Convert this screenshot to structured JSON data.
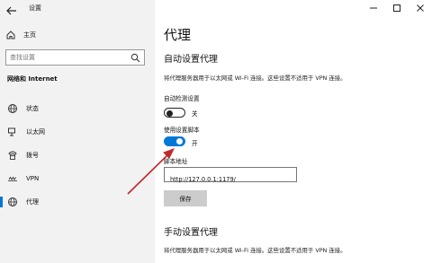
{
  "window": {
    "app_title": "设置",
    "controls": {
      "minimize": "minimize-icon",
      "maximize": "maximize-icon",
      "close": "close-icon"
    }
  },
  "sidebar": {
    "home_label": "主页",
    "search_placeholder": "查找设置",
    "section_title": "网络和 Internet",
    "items": [
      {
        "label": "状态",
        "icon": "globe-icon",
        "active": false
      },
      {
        "label": "以太网",
        "icon": "ethernet-icon",
        "active": false
      },
      {
        "label": "拨号",
        "icon": "phone-icon",
        "active": false
      },
      {
        "label": "VPN",
        "icon": "vpn-icon",
        "active": false
      },
      {
        "label": "代理",
        "icon": "globe-icon",
        "active": true
      }
    ]
  },
  "main": {
    "page_title": "代理",
    "auto_section": {
      "heading": "自动设置代理",
      "description": "将代理服务器用于以太网或 Wi-Fi 连接。这些设置不适用于 VPN 连接。",
      "auto_detect_label": "自动检测设置",
      "auto_detect_state": "关",
      "auto_detect_on": false,
      "use_script_label": "使用设置脚本",
      "use_script_state": "开",
      "use_script_on": true,
      "script_address_label": "脚本地址",
      "script_address_value": "http://127.0.0.1:1179/",
      "save_label": "保存"
    },
    "manual_section": {
      "heading": "手动设置代理",
      "description": "将代理服务器用于以太网或 Wi-Fi 连接。这些设置不适用于 VPN 连接。"
    }
  },
  "colors": {
    "accent": "#0078d7",
    "arrow": "#c0282d",
    "sidebar_bg": "#f2f2f2"
  }
}
